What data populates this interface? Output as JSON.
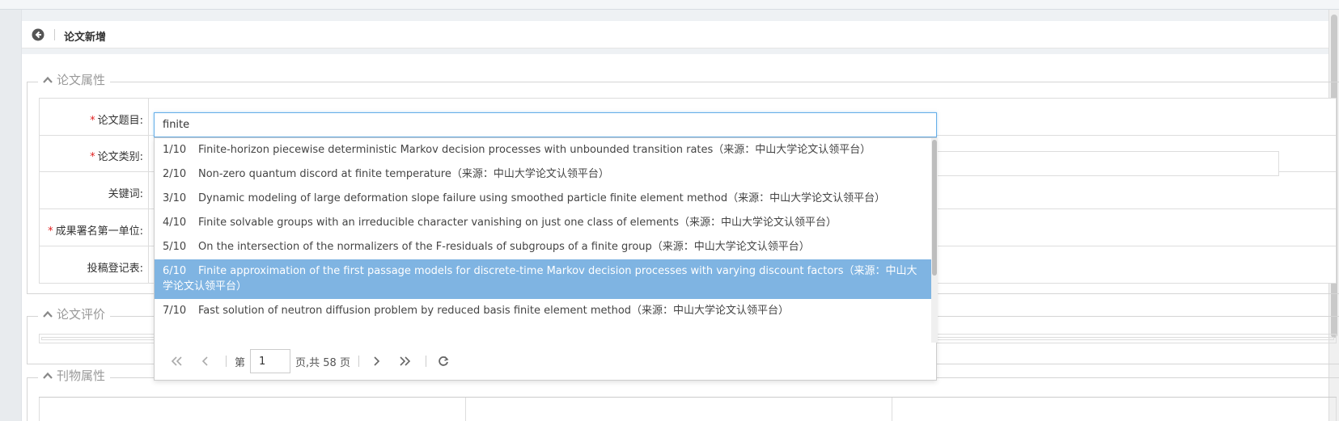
{
  "page_title": "论文新增",
  "sections": {
    "properties": "论文属性",
    "evaluation": "论文评价",
    "journal": "刊物属性"
  },
  "form": {
    "title_label": "论文题目:",
    "category_label": "论文类别:",
    "keywords_label": "关键词:",
    "first_unit_label": "成果署名第一单位:",
    "submission_label": "投稿登记表:",
    "required_mark": "*",
    "title_value": "finite"
  },
  "suggestions": [
    {
      "index": "1/10",
      "text": "Finite-horizon piecewise deterministic Markov decision processes with unbounded transition rates（来源：中山大学论文认领平台）"
    },
    {
      "index": "2/10",
      "text": "Non-zero quantum discord at finite temperature（来源：中山大学论文认领平台）"
    },
    {
      "index": "3/10",
      "text": "Dynamic modeling of large deformation slope failure using smoothed particle finite element method（来源：中山大学论文认领平台）"
    },
    {
      "index": "4/10",
      "text": "Finite solvable groups with an irreducible character vanishing on just one class of elements（来源：中山大学论文认领平台）"
    },
    {
      "index": "5/10",
      "text": "On the intersection of the normalizers of the F-residuals of subgroups of a finite group（来源：中山大学论文认领平台）"
    },
    {
      "index": "6/10",
      "text": "Finite approximation of the first passage models for discrete-time Markov decision processes with varying discount factors（来源：中山大学论文认领平台）",
      "selected": true
    },
    {
      "index": "7/10",
      "text": "Fast solution of neutron diffusion problem by reduced basis finite element method（来源：中山大学论文认领平台）"
    }
  ],
  "pager": {
    "page_prefix": "第",
    "current_page": "1",
    "page_suffix": "页,共 58 页"
  },
  "icons": {
    "back": "circle-arrow-left-icon",
    "first": "double-chevron-left-icon",
    "prev": "chevron-left-icon",
    "next": "chevron-right-icon",
    "last": "double-chevron-right-icon",
    "refresh": "refresh-icon",
    "collapse": "chevron-up-icon"
  },
  "colors": {
    "selected_row": "#7fb4e2",
    "required": "#e02020",
    "focus_border": "#66afe9"
  }
}
